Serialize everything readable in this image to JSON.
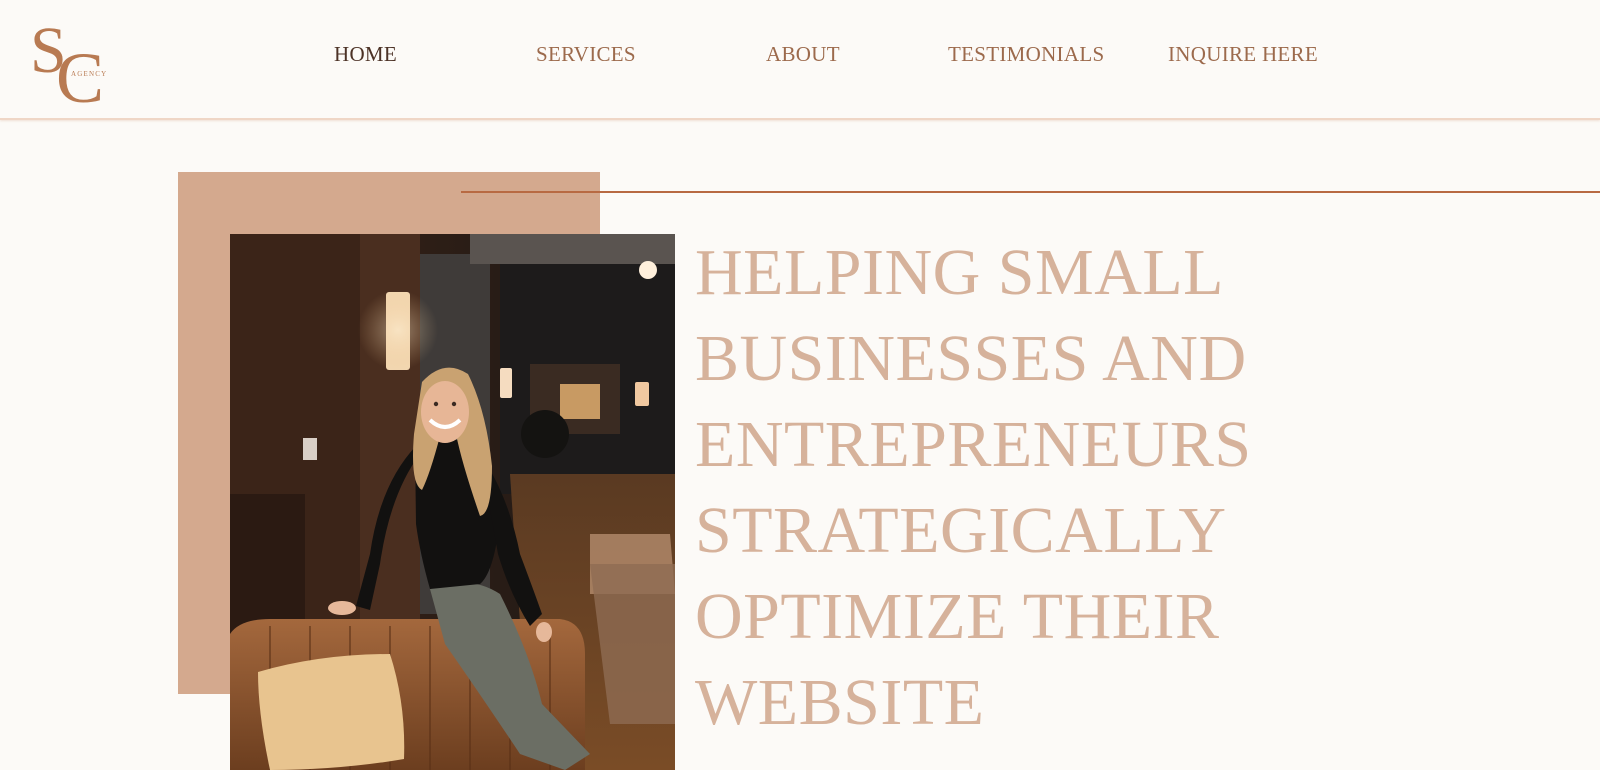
{
  "logo": {
    "letters": "SC",
    "tagline": "AGENCY",
    "brand_color": "#b87a52"
  },
  "nav": {
    "items": [
      {
        "label": "HOME"
      },
      {
        "label": "SERVICES"
      },
      {
        "label": "ABOUT"
      },
      {
        "label": "TESTIMONIALS"
      },
      {
        "label": "INQUIRE HERE"
      }
    ]
  },
  "hero": {
    "headline_lines": [
      "HELPING SMALL",
      "BUSINESSES AND",
      "ENTREPRENEURS",
      "STRATEGICALLY",
      "OPTIMIZE THEIR",
      "WEBSITE"
    ],
    "photo_subject": "woman-seated-on-leather-chair"
  },
  "colors": {
    "background": "#fcfaf7",
    "accent_block": "#d4a98e",
    "accent_line": "#b86a42",
    "headline": "#d6b29b",
    "nav_text": "#9c6a4c",
    "nav_active": "#4c3226"
  }
}
